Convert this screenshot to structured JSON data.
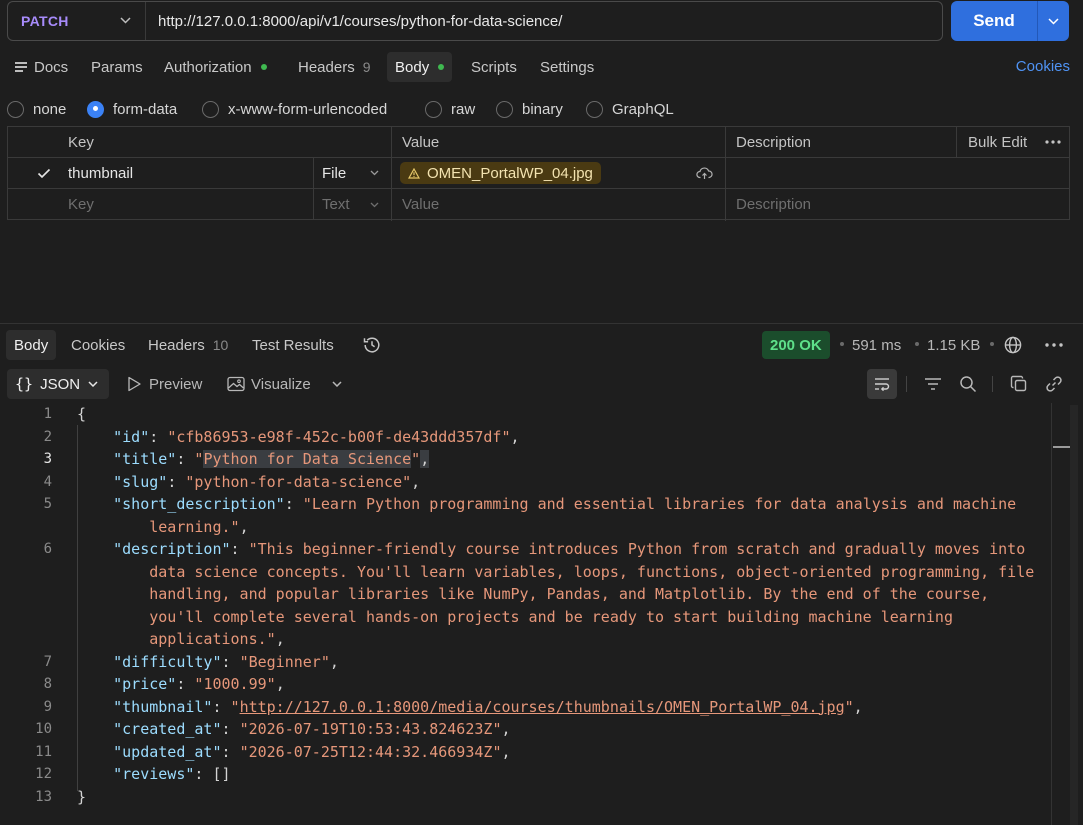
{
  "request": {
    "method": "PATCH",
    "url": "http://127.0.0.1:8000/api/v1/courses/python-for-data-science/",
    "send_label": "Send"
  },
  "request_tabs": {
    "docs": "Docs",
    "params": "Params",
    "authorization": "Authorization",
    "headers": "Headers",
    "headers_count": "9",
    "body": "Body",
    "scripts": "Scripts",
    "settings": "Settings",
    "cookies": "Cookies"
  },
  "body_types": {
    "none": "none",
    "form_data": "form-data",
    "urlencoded": "x-www-form-urlencoded",
    "raw": "raw",
    "binary": "binary",
    "graphql": "GraphQL",
    "selected": "form-data"
  },
  "form_table": {
    "headers": {
      "key": "Key",
      "value": "Value",
      "description": "Description",
      "bulk_edit": "Bulk Edit"
    },
    "row": {
      "key": "thumbnail",
      "type": "File",
      "file": "OMEN_PortalWP_04.jpg",
      "checked": true
    },
    "placeholder": {
      "key": "Key",
      "type": "Text",
      "value": "Value",
      "description": "Description"
    }
  },
  "response_tabs": {
    "body": "Body",
    "cookies": "Cookies",
    "headers": "Headers",
    "headers_count": "10",
    "test_results": "Test Results"
  },
  "response_meta": {
    "status": "200 OK",
    "time": "591 ms",
    "size": "1.15 KB"
  },
  "response_tools": {
    "format": "JSON",
    "preview": "Preview",
    "visualize": "Visualize"
  },
  "response_json": {
    "id": "cfb86953-e98f-452c-b00f-de43ddd357df",
    "title": "Python for Data Science",
    "slug": "python-for-data-science",
    "short_description_1": "Learn Python programming and essential libraries for data analysis and machine",
    "short_description_2": "learning.",
    "description_1": "This beginner-friendly course introduces Python from scratch and gradually moves into",
    "description_2": "data science concepts. You'll learn variables, loops, functions, object-oriented programming, file",
    "description_3": "handling, and popular libraries like NumPy, Pandas, and Matplotlib. By the end of the course,",
    "description_4": "you'll complete several hands-on projects and be ready to start building machine learning",
    "description_5": "applications.",
    "difficulty": "Beginner",
    "price": "1000.99",
    "thumbnail": "http://127.0.0.1:8000/media/courses/thumbnails/OMEN_PortalWP_04.jpg",
    "created_at": "2026-07-19T10:53:43.824623Z",
    "updated_at": "2026-07-25T12:44:32.466934Z",
    "reviews": "[]"
  },
  "line_numbers": [
    "1",
    "2",
    "3",
    "4",
    "5",
    "6",
    "7",
    "8",
    "9",
    "10",
    "11",
    "12",
    "13"
  ],
  "colors": {
    "accent": "#2f6fde",
    "method": "#a78bfa",
    "status_ok": "#5ee08a",
    "string": "#e6977a",
    "key": "#9cdcfe"
  }
}
